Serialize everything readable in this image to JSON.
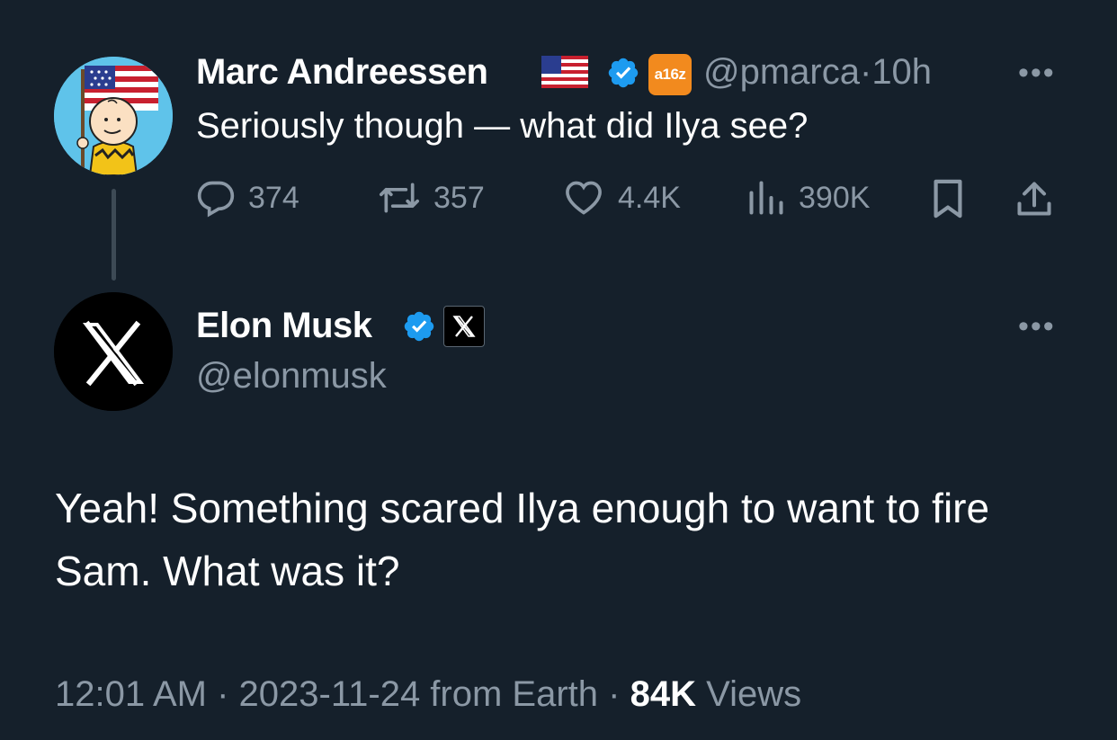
{
  "parent_tweet": {
    "author_name": "Marc Andreessen",
    "flag": "🇺🇸",
    "affiliation_badge": "a16z",
    "handle": "@pmarca",
    "separator": "·",
    "time_ago": "10h",
    "text": "Seriously though — what did Ilya see?",
    "more": "•••",
    "metrics": {
      "replies": "374",
      "reposts": "357",
      "likes": "4.4K",
      "views": "390K"
    }
  },
  "main_tweet": {
    "author_name": "Elon Musk",
    "handle": "@elonmusk",
    "more": "•••",
    "text": "Yeah! Something scared Ilya enough to want to fire Sam. What was it?",
    "timestamp": "12:01 AM · 2023-11-24 from Earth ·",
    "views_count": "84K",
    "views_label": "Views"
  },
  "icons": {
    "verified": "verified-badge-icon",
    "reply": "reply-icon",
    "repost": "repost-icon",
    "like": "heart-icon",
    "views": "analytics-icon",
    "bookmark": "bookmark-icon",
    "share": "share-icon",
    "x_logo": "x-logo-icon"
  },
  "colors": {
    "background": "#15202b",
    "text": "#ffffff",
    "secondary": "#8b98a5",
    "verified_blue": "#1d9bf0",
    "a16z_orange": "#f28a1e"
  }
}
